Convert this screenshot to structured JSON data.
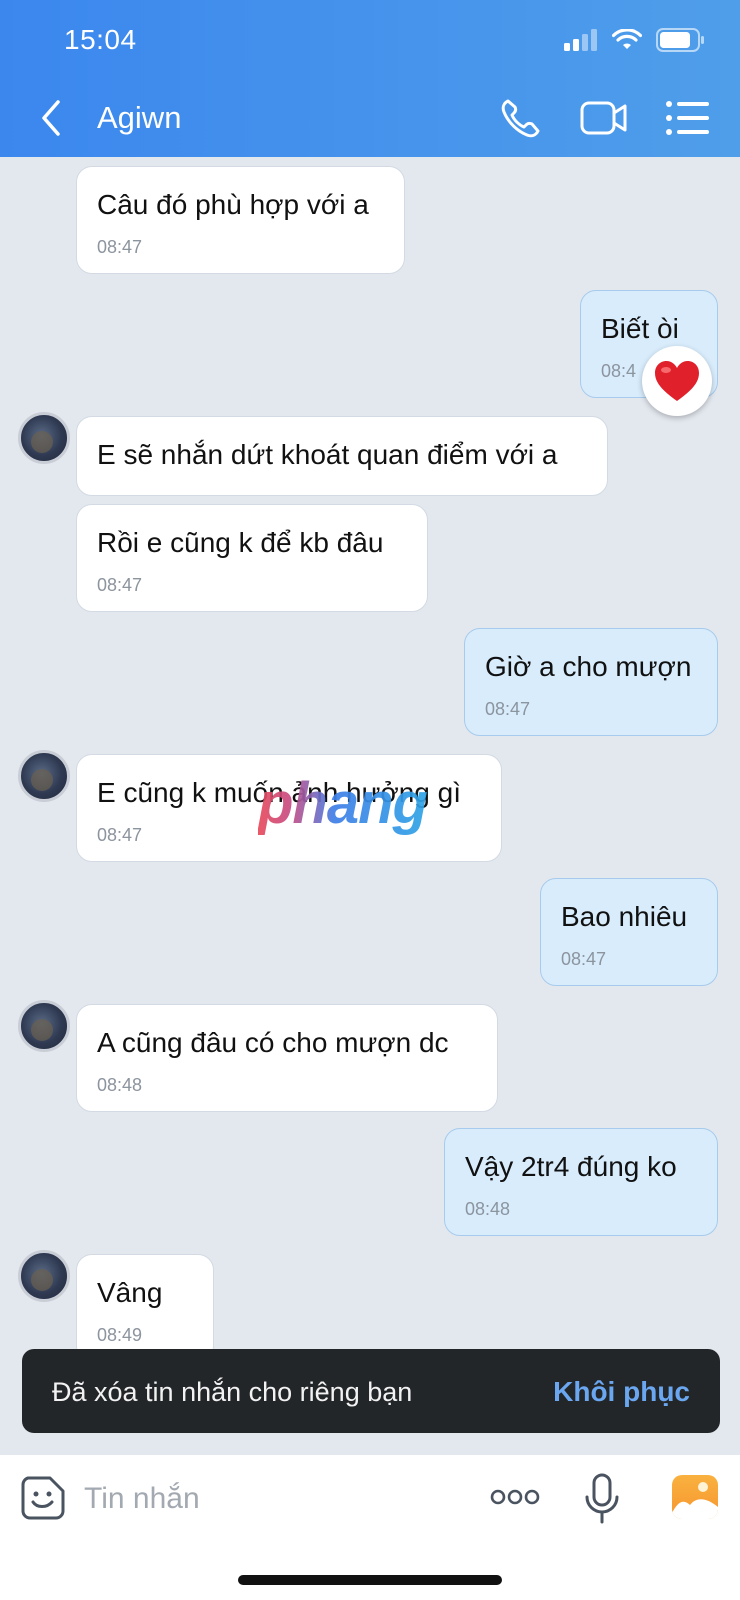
{
  "status_bar": {
    "time": "15:04"
  },
  "header": {
    "contact_name": "Agiwn",
    "icons": {
      "back": "chevron-left-icon",
      "call": "phone-icon",
      "video": "video-camera-icon",
      "menu": "list-menu-icon"
    }
  },
  "messages": [
    {
      "direction": "in",
      "text": "Câu đó phù hợp với a",
      "time": "08:47"
    },
    {
      "direction": "out",
      "text": "Biết òi",
      "time": "08:4",
      "reaction": "heart"
    },
    {
      "direction": "in",
      "text": "E sẽ nhắn dứt khoát quan điểm với a",
      "time": ""
    },
    {
      "direction": "in",
      "text": "Rồi e cũng k để kb đâu",
      "time": "08:47"
    },
    {
      "direction": "out",
      "text": "Giờ a cho mượn",
      "time": "08:47"
    },
    {
      "direction": "in",
      "text": "E cũng k muốn ảnh hưởng gì",
      "time": "08:47"
    },
    {
      "direction": "out",
      "text": "Bao nhiêu",
      "time": "08:47"
    },
    {
      "direction": "in",
      "text": "A cũng đâu có cho mượn dc",
      "time": "08:48"
    },
    {
      "direction": "out",
      "text": "Vậy 2tr4 đúng ko",
      "time": "08:48"
    },
    {
      "direction": "in",
      "text": "Vâng",
      "time": "08:49"
    }
  ],
  "watermark": "phang",
  "toast": {
    "text": "Đã xóa tin nhắn cho riêng bạn",
    "action": "Khôi phục"
  },
  "composer": {
    "placeholder": "Tin nhắn",
    "icons": {
      "sticker": "sticker-smile-icon",
      "more": "more-dots-icon",
      "mic": "microphone-icon",
      "image": "image-gallery-icon"
    }
  }
}
